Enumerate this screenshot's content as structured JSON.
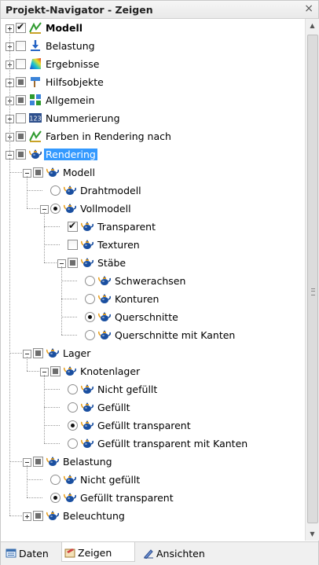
{
  "panel": {
    "title": "Projekt-Navigator - Zeigen",
    "close_glyph": "×"
  },
  "tree": [
    {
      "label": "Modell",
      "bold": true,
      "control": "checkbox",
      "state": "checked",
      "icon": "model-icon"
    },
    {
      "label": "Belastung",
      "control": "checkbox",
      "state": "unchecked",
      "icon": "load-icon"
    },
    {
      "label": "Ergebnisse",
      "control": "checkbox",
      "state": "unchecked",
      "icon": "results-icon"
    },
    {
      "label": "Hilfsobjekte",
      "control": "checkbox",
      "state": "indeterminate",
      "icon": "guide-object-icon"
    },
    {
      "label": "Allgemein",
      "control": "checkbox",
      "state": "indeterminate",
      "icon": "general-icon"
    },
    {
      "label": "Nummerierung",
      "control": "checkbox",
      "state": "unchecked",
      "icon": "numbering-icon"
    },
    {
      "label": "Farben in Rendering nach",
      "control": "checkbox",
      "state": "indeterminate",
      "icon": "colors-icon"
    },
    {
      "label": "Rendering",
      "selected": true,
      "control": "checkbox",
      "state": "indeterminate",
      "icon": "teapot-icon"
    },
    {
      "label": "Modell",
      "control": "checkbox",
      "state": "indeterminate",
      "icon": "teapot-icon"
    },
    {
      "label": "Drahtmodell",
      "control": "radio",
      "state": "unselected",
      "icon": "teapot-icon"
    },
    {
      "label": "Vollmodell",
      "control": "radio",
      "state": "selected",
      "icon": "teapot-icon"
    },
    {
      "label": "Transparent",
      "control": "checkbox",
      "state": "checked",
      "icon": "teapot-icon"
    },
    {
      "label": "Texturen",
      "control": "checkbox",
      "state": "unchecked",
      "icon": "teapot-icon"
    },
    {
      "label": "Stäbe",
      "control": "checkbox",
      "state": "indeterminate",
      "icon": "teapot-icon"
    },
    {
      "label": "Schwerachsen",
      "control": "radio",
      "state": "unselected",
      "icon": "teapot-icon"
    },
    {
      "label": "Konturen",
      "control": "radio",
      "state": "unselected",
      "icon": "teapot-icon"
    },
    {
      "label": "Querschnitte",
      "control": "radio",
      "state": "selected",
      "icon": "teapot-icon"
    },
    {
      "label": "Querschnitte mit Kanten",
      "control": "radio",
      "state": "unselected",
      "icon": "teapot-icon"
    },
    {
      "label": "Lager",
      "control": "checkbox",
      "state": "indeterminate",
      "icon": "teapot-icon"
    },
    {
      "label": "Knotenlager",
      "control": "checkbox",
      "state": "indeterminate",
      "icon": "teapot-icon"
    },
    {
      "label": "Nicht gefüllt",
      "control": "radio",
      "state": "unselected",
      "icon": "teapot-icon"
    },
    {
      "label": "Gefüllt",
      "control": "radio",
      "state": "unselected",
      "icon": "teapot-icon"
    },
    {
      "label": "Gefüllt transparent",
      "control": "radio",
      "state": "selected",
      "icon": "teapot-icon"
    },
    {
      "label": "Gefüllt transparent mit Kanten",
      "control": "radio",
      "state": "unselected",
      "icon": "teapot-icon"
    },
    {
      "label": "Belastung",
      "control": "checkbox",
      "state": "indeterminate",
      "icon": "teapot-icon"
    },
    {
      "label": "Nicht gefüllt",
      "control": "radio",
      "state": "unselected",
      "icon": "teapot-icon"
    },
    {
      "label": "Gefüllt transparent",
      "control": "radio",
      "state": "selected",
      "icon": "teapot-icon"
    },
    {
      "label": "Beleuchtung",
      "control": "checkbox",
      "state": "indeterminate",
      "icon": "teapot-icon"
    }
  ],
  "tabs": [
    {
      "label": "Daten",
      "icon": "data-tab-icon"
    },
    {
      "label": "Zeigen",
      "icon": "display-tab-icon",
      "active": true
    },
    {
      "label": "Ansichten",
      "icon": "views-tab-icon"
    }
  ],
  "colors": {
    "selection": "#3399ff",
    "teapot": "#1a4fa0"
  }
}
